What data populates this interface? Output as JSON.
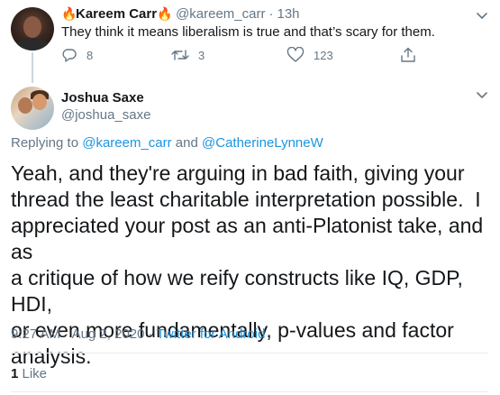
{
  "parent_tweet": {
    "display_name": "Kareem Carr",
    "name_emoji_left": "fire-icon",
    "name_emoji_right": "fire-icon",
    "handle": "@kareem_carr",
    "separator": "·",
    "time": "13h",
    "text": "They think it means liberalism is true and that’s scary for them.",
    "actions": {
      "replies": "8",
      "retweets": "3",
      "likes": "123"
    },
    "icons": [
      "reply-icon",
      "retweet-icon",
      "like-icon",
      "share-icon",
      "caret-down-icon"
    ]
  },
  "main_tweet": {
    "display_name": "Joshua Saxe",
    "handle": "@joshua_saxe",
    "replying_prefix": "Replying to ",
    "replying_user_1": "@kareem_carr",
    "replying_and": " and ",
    "replying_user_2": "@CatherineLynneW",
    "text": "Yeah, and they're arguing in bad faith, giving your\nthread the least charitable interpretation possible.  I\nappreciated your post as an anti-Platonist take, and as\na critique of how we reify constructs like IQ, GDP, HDI,\nor even more fundamentally, p-values and factor\nanalysis.",
    "time": "9:27 AM",
    "date_separator": " · ",
    "date": "Aug 2, 2020",
    "source_separator": " · ",
    "source": "Twitter for Android",
    "like_count": "1",
    "like_label": " Like"
  },
  "colors": {
    "text": "#14171a",
    "secondary": "#657786",
    "link": "#1b95e0",
    "divider": "#e6ecf0",
    "thread_line": "#ccd6dd",
    "fire": "#f4900c"
  }
}
